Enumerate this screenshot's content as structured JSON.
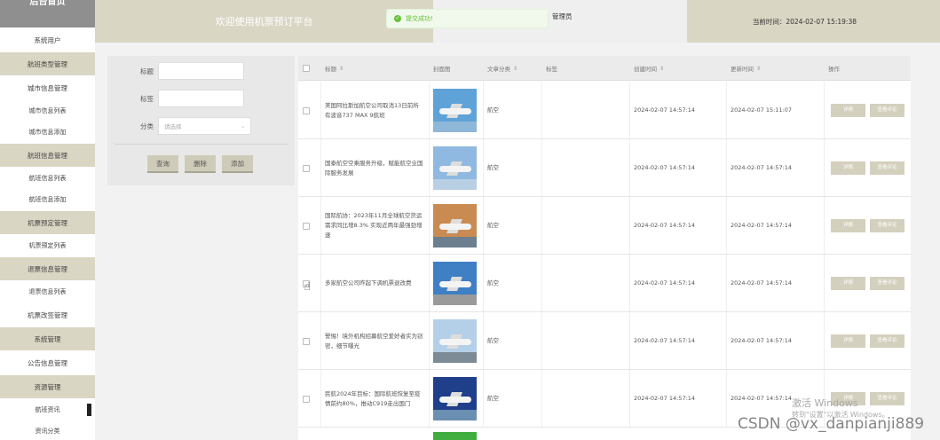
{
  "sidebar": {
    "header": "后台首页",
    "items": [
      {
        "label": "系统用户",
        "kind": "plain"
      },
      {
        "label": "航班类型管理",
        "kind": "group"
      },
      {
        "label": "城市信息管理",
        "kind": "plain"
      },
      {
        "label": "城市信息列表",
        "kind": "sub"
      },
      {
        "label": "城市信息添加",
        "kind": "sub"
      },
      {
        "label": "航班信息管理",
        "kind": "group"
      },
      {
        "label": "航班信息列表",
        "kind": "sub"
      },
      {
        "label": "航班信息添加",
        "kind": "sub"
      },
      {
        "label": "机票预定管理",
        "kind": "group"
      },
      {
        "label": "机票预定列表",
        "kind": "sub"
      },
      {
        "label": "退票信息管理",
        "kind": "group"
      },
      {
        "label": "退票信息列表",
        "kind": "sub"
      },
      {
        "label": "机票改签管理",
        "kind": "plain"
      },
      {
        "label": "系统管理",
        "kind": "group"
      },
      {
        "label": "公告信息管理",
        "kind": "plain"
      },
      {
        "label": "资源管理",
        "kind": "group"
      },
      {
        "label": "航班资讯",
        "kind": "sub",
        "active": true
      },
      {
        "label": "资讯分类",
        "kind": "sub"
      }
    ]
  },
  "header": {
    "title": "欢迎使用机票预订平台",
    "admin": "管理员",
    "time_label": "当前时间：2024-02-07 15:19:38"
  },
  "toast": {
    "text": "提交成功!"
  },
  "search": {
    "title_label": "标题",
    "title_value": "",
    "tag_label": "标签",
    "tag_value": "",
    "category_label": "分类",
    "category_placeholder": "请选择",
    "query_button": "查询",
    "delete_button": "删除",
    "add_button": "添加"
  },
  "table": {
    "columns": [
      "标题",
      "封面图",
      "文章分类",
      "标签",
      "创建时间",
      "更新时间",
      "操作"
    ],
    "rows": [
      {
        "title": "美国阿拉斯加航空公司取消13日前所有波音737 MAX 9航班",
        "category": "航空",
        "tag": "",
        "created": "2024-02-07 14:57:14",
        "updated": "2024-02-07 15:11:07",
        "sky": "#5fa2d8",
        "ground": "#8fb7d8"
      },
      {
        "title": "国泰航空空乘服务升级，赋能航空业国际服务发展",
        "category": "航空",
        "tag": "",
        "created": "2024-02-07 14:57:14",
        "updated": "2024-02-07 14:57:14",
        "sky": "#8fb9e0",
        "ground": "#b9cfe4"
      },
      {
        "title": "国际航协：2023年11月全球航空货运需求同比增8.3% 实现近两年最强劲增速",
        "category": "航空",
        "tag": "",
        "created": "2024-02-07 14:57:14",
        "updated": "2024-02-07 14:57:14",
        "sky": "#c98b52",
        "ground": "#6b7f8e"
      },
      {
        "title": "多家航空公司昨起下调机票退改费",
        "category": "航空",
        "tag": "",
        "created": "2024-02-07 14:57:14",
        "updated": "2024-02-07 14:57:14",
        "sky": "#3f7fc4",
        "ground": "#9a9a9a"
      },
      {
        "title": "警惕！境外机构招募航空爱好者实为窃密，细节曝光",
        "category": "航空",
        "tag": "",
        "created": "2024-02-07 14:57:14",
        "updated": "2024-02-07 14:57:14",
        "sky": "#b4cfe8",
        "ground": "#7d8b96"
      },
      {
        "title": "民航2024年目标：国际航班恢复至疫情前约80%，推动C919走出国门",
        "category": "航空",
        "tag": "",
        "created": "2024-02-07 14:57:14",
        "updated": "2024-02-07 14:57:14",
        "sky": "#1f3f8a",
        "ground": "#6a8fb0"
      }
    ],
    "detail_button": "详情",
    "comment_button": "查看评论"
  },
  "watermark": {
    "activate": "激活 Windows",
    "activate_hint": "转到\"设置\"以激活 Windows。",
    "csdn": "CSDN @vx_danpianji889"
  },
  "colors": {
    "accent": "#dad6c4",
    "button": "#d4d0be",
    "success": "#67c23a"
  },
  "icons": {
    "sort": "sort-icon",
    "check": "check-circle-icon",
    "chevron": "chevron-down-icon",
    "cursor": "hand-cursor-icon"
  }
}
